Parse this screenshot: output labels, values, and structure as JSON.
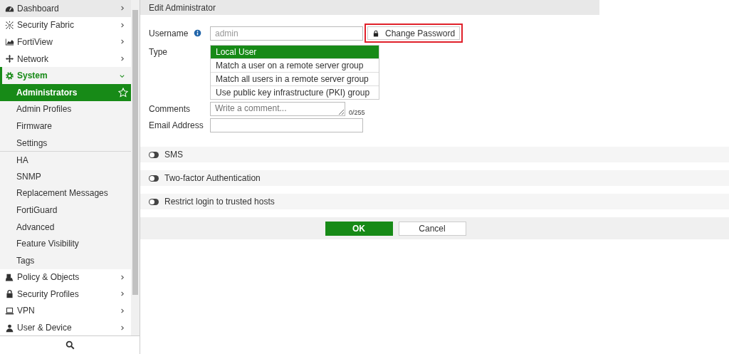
{
  "sidebar": {
    "items": [
      {
        "label": "Dashboard",
        "expanded": false,
        "selected": false,
        "hovered": true
      },
      {
        "label": "Security Fabric",
        "expanded": false,
        "selected": false,
        "hovered": false
      },
      {
        "label": "FortiView",
        "expanded": false,
        "selected": false,
        "hovered": false
      },
      {
        "label": "Network",
        "expanded": false,
        "selected": false,
        "hovered": false
      },
      {
        "label": "System",
        "expanded": true,
        "selected": true,
        "hovered": false,
        "children": [
          {
            "label": "Administrators",
            "selected": true,
            "favorite": false,
            "separator": false
          },
          {
            "label": "Admin Profiles",
            "selected": false,
            "separator": false
          },
          {
            "label": "Firmware",
            "selected": false,
            "separator": false
          },
          {
            "label": "Settings",
            "selected": false,
            "separator": false
          },
          {
            "label": "HA",
            "selected": false,
            "separator": true
          },
          {
            "label": "SNMP",
            "selected": false,
            "separator": false
          },
          {
            "label": "Replacement Messages",
            "selected": false,
            "separator": false
          },
          {
            "label": "FortiGuard",
            "selected": false,
            "separator": false
          },
          {
            "label": "Advanced",
            "selected": false,
            "separator": false
          },
          {
            "label": "Feature Visibility",
            "selected": false,
            "separator": false
          },
          {
            "label": "Tags",
            "selected": false,
            "separator": false
          }
        ]
      },
      {
        "label": "Policy & Objects",
        "expanded": false,
        "selected": false,
        "hovered": false
      },
      {
        "label": "Security Profiles",
        "expanded": false,
        "selected": false,
        "hovered": false
      },
      {
        "label": "VPN",
        "expanded": false,
        "selected": false,
        "hovered": false
      },
      {
        "label": "User & Device",
        "expanded": false,
        "selected": false,
        "hovered": false
      }
    ]
  },
  "page": {
    "title": "Edit Administrator",
    "username": {
      "label": "Username",
      "value": "admin",
      "change_password": {
        "label": "Change Password",
        "highlighted": true
      }
    },
    "type": {
      "label": "Type",
      "options": [
        {
          "label": "Local User",
          "selected": true
        },
        {
          "label": "Match a user on a remote server group",
          "selected": false
        },
        {
          "label": "Match all users in a remote server group",
          "selected": false
        },
        {
          "label": "Use public key infrastructure (PKI) group",
          "selected": false
        }
      ]
    },
    "comments": {
      "label": "Comments",
      "placeholder": "Write a comment...",
      "counter": "0/255"
    },
    "email": {
      "label": "Email Address"
    },
    "toggles": [
      {
        "label": "SMS",
        "on": false
      },
      {
        "label": "Two-factor Authentication",
        "on": false
      },
      {
        "label": "Restrict login to trusted hosts",
        "on": false
      }
    ],
    "buttons": [
      {
        "label": "OK",
        "kind": "primary"
      },
      {
        "label": "Cancel",
        "kind": "secondary"
      }
    ]
  }
}
